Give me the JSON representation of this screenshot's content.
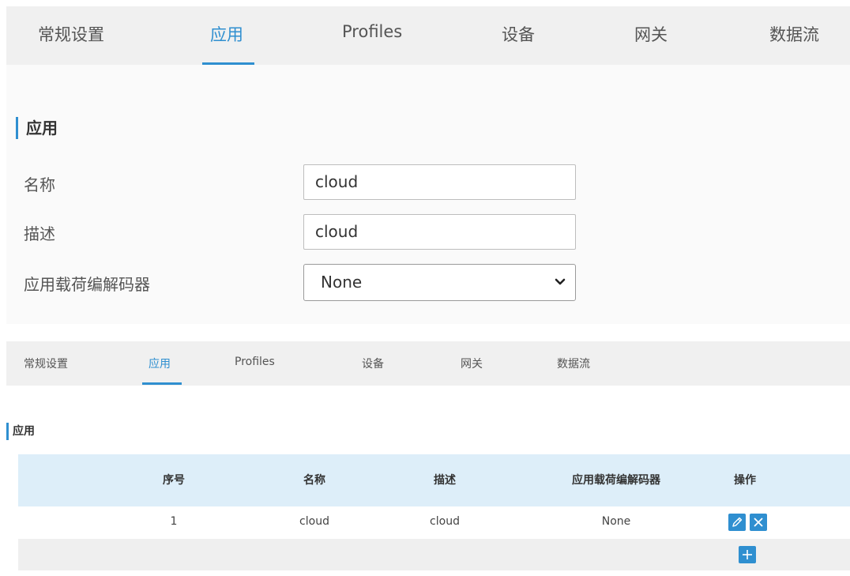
{
  "tabs": [
    "常规设置",
    "应用",
    "Profiles",
    "设备",
    "网关",
    "数据流"
  ],
  "active_tab": "应用",
  "form": {
    "section_title": "应用",
    "name_label": "名称",
    "name_value": "cloud",
    "desc_label": "描述",
    "desc_value": "cloud",
    "codec_label": "应用载荷编解码器",
    "codec_value": "None"
  },
  "list": {
    "section_title": "应用",
    "columns": [
      "序号",
      "名称",
      "描述",
      "应用载荷编解码器",
      "操作"
    ],
    "rows": [
      [
        "1",
        "cloud",
        "cloud",
        "None"
      ]
    ]
  },
  "icons": {
    "edit": "edit-icon",
    "delete": "delete-icon",
    "add": "add-icon",
    "dropdown": "chevron-down-icon"
  },
  "colors": {
    "accent": "#2f8fd0",
    "tab_bar_bg": "#f0f0f0",
    "table_header_bg": "#ddeef9"
  }
}
